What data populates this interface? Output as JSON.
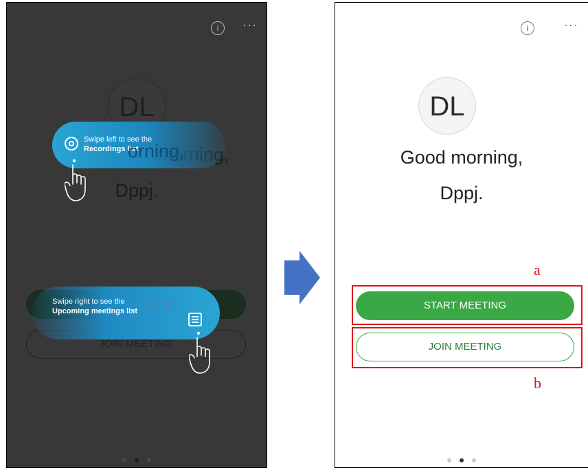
{
  "left_screen": {
    "info_icon": "info-icon",
    "more_icon": "more-icon",
    "more_text": "···",
    "avatar_initials": "DL",
    "greeting_line1": "Good morning,",
    "greeting_line2": "Dppj.",
    "start_button": "START MEETING",
    "join_button": "JOIN MEETING",
    "hint_recordings": {
      "line1": "Swipe left to see the",
      "line2": "Recordings list",
      "faded_text": "orning,"
    },
    "hint_upcoming": {
      "line1": "Swipe right to see the",
      "line2": "Upcoming meetings list",
      "faded_text": "ETING"
    }
  },
  "right_screen": {
    "info_icon": "info-icon",
    "more_icon": "more-icon",
    "more_text": "···",
    "avatar_initials": "DL",
    "greeting_line1": "Good morning,",
    "greeting_line2": "Dppj.",
    "start_button": "START MEETING",
    "join_button": "JOIN MEETING"
  },
  "annotations": {
    "label_a": "a",
    "label_b": "b"
  },
  "colors": {
    "accent_green": "#3aa845",
    "hint_blue": "#1f8ac2",
    "annotation_red": "#e0141b",
    "arrow_blue": "#4472c4"
  }
}
